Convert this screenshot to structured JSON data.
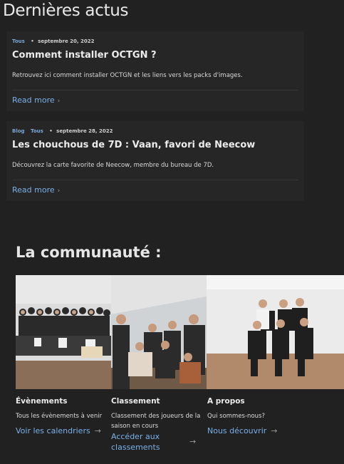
{
  "news": {
    "title": "Dernières actus",
    "posts": [
      {
        "categories": [
          "Tous"
        ],
        "date": "septembre 20, 2022",
        "title": "Comment installer OCTGN ?",
        "excerpt": "Retrouvez ici comment installer OCTGN et les liens vers les packs d'images.",
        "read_more": "Read more"
      },
      {
        "categories": [
          "Blog",
          "Tous"
        ],
        "date": "septembre 28, 2022",
        "title": "Les chouchous de 7D : Vaan, favori de Neecow",
        "excerpt": "Découvrez la carte favorite de Neecow, membre du bureau de 7D.",
        "read_more": "Read more"
      }
    ]
  },
  "community": {
    "title": "La communauté :",
    "columns": [
      {
        "heading": "Évènements",
        "description": "Tous les évènements à venir",
        "link": "Voir les calendriers"
      },
      {
        "heading": "Classement",
        "description": "Classement des joueurs de la saison en cours",
        "link": "Accéder aux classements"
      },
      {
        "heading": "A propos",
        "description": "Qui sommes-nous?",
        "link": "Nous découvrir"
      }
    ]
  },
  "colors": {
    "background": "#212121",
    "card": "#262626",
    "link": "#7ab0e8"
  }
}
